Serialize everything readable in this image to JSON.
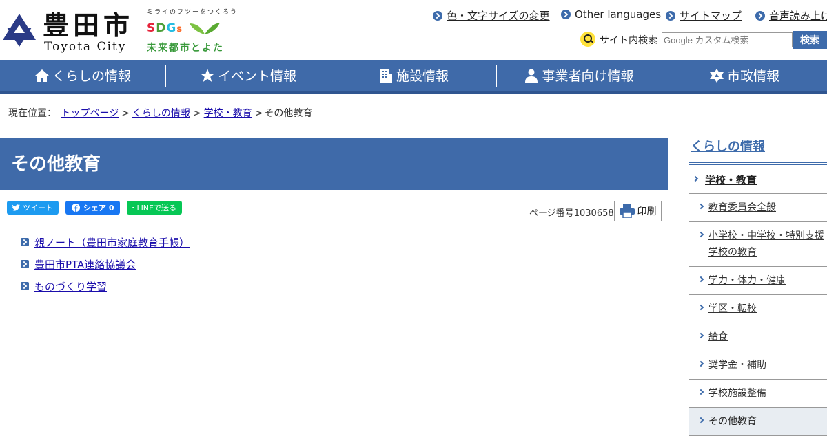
{
  "header": {
    "logo_kanji": "豊田市",
    "logo_roman": "Toyota City",
    "sdgs_tagline": "ミライのフツーをつくろう",
    "sdgs_letters": [
      "S",
      "D",
      "G",
      "s"
    ],
    "sdgs_subtitle": "未来都市とよた",
    "utility_links": [
      "色・文字サイズの変更",
      "Other languages",
      "サイトマップ",
      "音声読み上げ"
    ],
    "search": {
      "label": "サイト内検索",
      "placeholder": "Google カスタム検索",
      "button": "検索"
    }
  },
  "gnav": [
    {
      "label": "くらしの情報",
      "icon": "house-icon"
    },
    {
      "label": "イベント情報",
      "icon": "star-icon"
    },
    {
      "label": "施設情報",
      "icon": "building-icon"
    },
    {
      "label": "事業者向け情報",
      "icon": "person-icon"
    },
    {
      "label": "市政情報",
      "icon": "city-emblem-icon"
    }
  ],
  "breadcrumb": {
    "label": "現在位置：",
    "items": [
      "トップページ",
      "くらしの情報",
      "学校・教育"
    ],
    "current": "その他教育",
    "separator": ">"
  },
  "main": {
    "title": "その他教育",
    "share": {
      "tweet": "ツイート",
      "facebook": "シェア 0",
      "line": "LINEで送る"
    },
    "page_number": "ページ番号1030658",
    "print": "印刷",
    "links": [
      "親ノート（豊田市家庭教育手帳）",
      "豊田市PTA連絡協議会",
      "ものづくり学習"
    ]
  },
  "sidenav": {
    "title": "くらしの情報",
    "parent": "学校・教育",
    "items": [
      "教育委員会全般",
      "小学校・中学校・特別支援学校の教育",
      "学力・体力・健康",
      "学区・転校",
      "給食",
      "奨学金・補助",
      "学校施設整備",
      "その他教育"
    ]
  },
  "colors": {
    "brand_blue": "#3f6aa9",
    "sdgs_green": "#3a9a3c",
    "search_yellow": "#ffe23a"
  }
}
